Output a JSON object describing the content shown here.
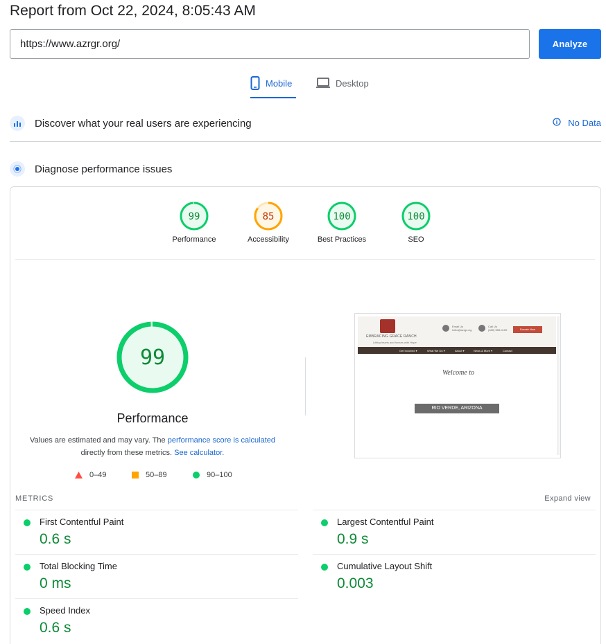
{
  "report": {
    "title": "Report from Oct 22, 2024, 8:05:43 AM"
  },
  "search": {
    "value": "https://www.azrgr.org/",
    "analyze_label": "Analyze"
  },
  "tabs": [
    {
      "label": "Mobile",
      "active": true,
      "icon": "smartphone-icon"
    },
    {
      "label": "Desktop",
      "active": false,
      "icon": "laptop-icon"
    }
  ],
  "field_data": {
    "title": "Discover what your real users are experiencing",
    "status": "No Data"
  },
  "diagnose": {
    "title": "Diagnose performance issues"
  },
  "categories": [
    {
      "name": "Performance",
      "score": "99",
      "fraction": 0.99,
      "color": "#0cce6b"
    },
    {
      "name": "Accessibility",
      "score": "85",
      "fraction": 0.85,
      "color": "#ffa400"
    },
    {
      "name": "Best Practices",
      "score": "100",
      "fraction": 1.0,
      "color": "#0cce6b"
    },
    {
      "name": "SEO",
      "score": "100",
      "fraction": 1.0,
      "color": "#0cce6b"
    }
  ],
  "performance": {
    "score": "99",
    "fraction": 0.99,
    "title": "Performance",
    "note_prefix": "Values are estimated and may vary. The ",
    "note_link1": "performance score is calculated",
    "note_middle": " directly from these metrics. ",
    "note_link2": "See calculator."
  },
  "legend": [
    {
      "range": "0–49",
      "shape": "triangle",
      "color": "#ff4e42"
    },
    {
      "range": "50–89",
      "shape": "square",
      "color": "#ffa400"
    },
    {
      "range": "90–100",
      "shape": "circle",
      "color": "#0cce6b"
    }
  ],
  "screenshot": {
    "logo_text": "EMBRACING GRACE RANCH",
    "tagline": "Lifting hearts and horses with Hope",
    "email_label": "Email Us",
    "email_value": "hello@azrgr.org",
    "call_label": "Call Us",
    "call_value": "(480) 555-0100",
    "donate": "Donate Now",
    "nav": [
      "Get Involved ▾",
      "What We Do ▾",
      "About ▾",
      "News & More ▾",
      "Contact"
    ],
    "welcome": "Welcome to",
    "banner": "RIO VERDE, ARIZONA"
  },
  "metrics": {
    "label": "METRICS",
    "expand": "Expand view",
    "items": [
      {
        "name": "First Contentful Paint",
        "value": "0.6 s"
      },
      {
        "name": "Largest Contentful Paint",
        "value": "0.9 s"
      },
      {
        "name": "Total Blocking Time",
        "value": "0 ms"
      },
      {
        "name": "Cumulative Layout Shift",
        "value": "0.003"
      },
      {
        "name": "Speed Index",
        "value": "0.6 s"
      }
    ]
  }
}
